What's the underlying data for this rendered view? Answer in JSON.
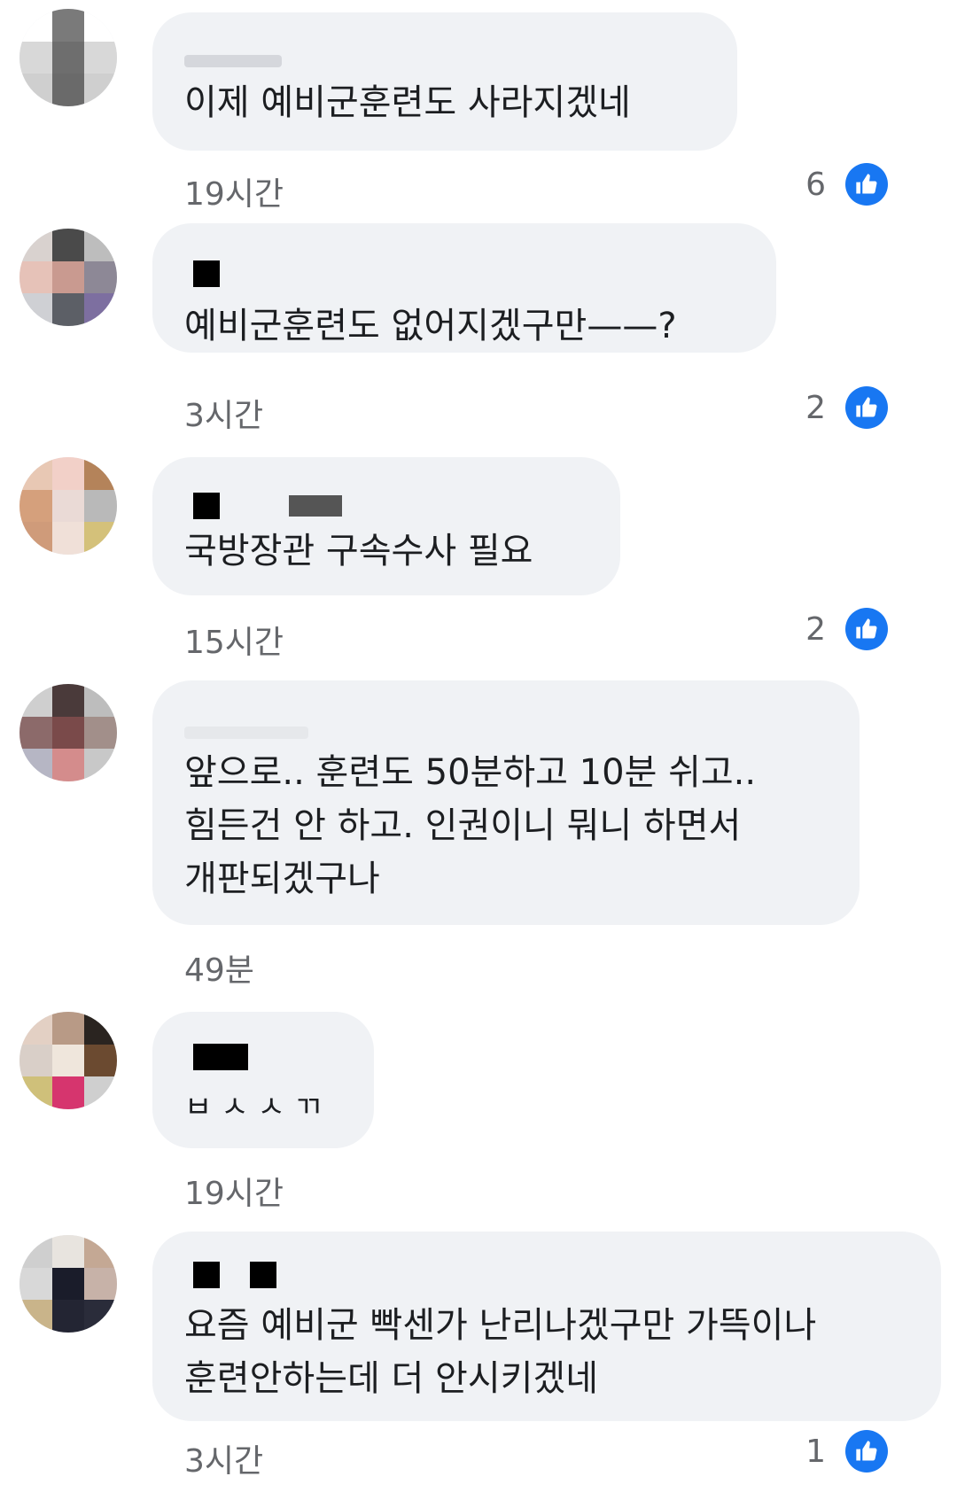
{
  "comments": [
    {
      "text": "이제 예비군훈련도 사라지겠네",
      "time": "19시간",
      "likes": "6"
    },
    {
      "text": "예비군훈련도 없어지겠구만——?",
      "time": "3시간",
      "likes": "2"
    },
    {
      "text": "국방장관 구속수사 필요",
      "time": "15시간",
      "likes": "2"
    },
    {
      "text": "앞으로.. 훈련도 50분하고 10분 쉬고..\n힘든건 안 하고. 인권이니 뭐니 하면서\n개판되겠구나",
      "time": "49분",
      "likes": ""
    },
    {
      "text": "ㅂㅅㅅㄲ",
      "time": "19시간",
      "likes": ""
    },
    {
      "text": "요즘 예비군 빡센가 난리나겠구만 가뜩이나\n훈련안하는데 더 안시키겠네",
      "time": "3시간",
      "likes": "1"
    }
  ],
  "icons": {
    "like": "thumbs-up-icon",
    "avatar": "pixelated-avatar"
  },
  "colors": {
    "like_blue": "#1877f2",
    "bubble_bg": "#f0f2f5",
    "meta_gray": "#65676b"
  }
}
